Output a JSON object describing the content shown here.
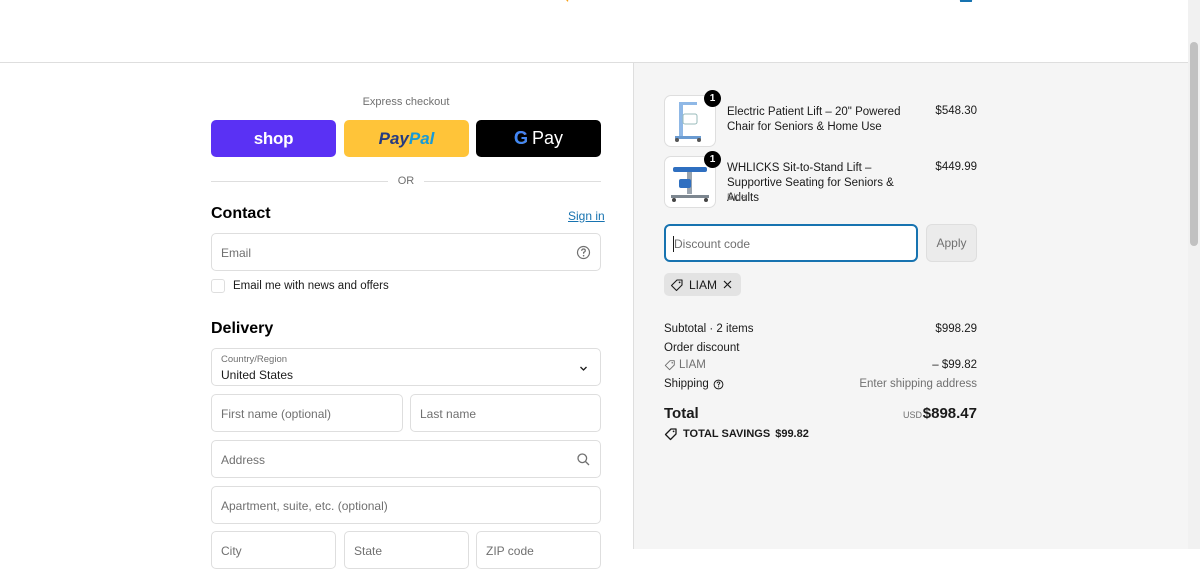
{
  "express": {
    "label": "Express checkout",
    "shop_label": "shop",
    "paypal_part1": "Pay",
    "paypal_part2": "Pal",
    "gpay_g": "G",
    "gpay_label": "Pay",
    "or_text": "OR"
  },
  "contact": {
    "title": "Contact",
    "signin": "Sign in",
    "email_placeholder": "Email",
    "newsletter_label": "Email me with news and offers"
  },
  "delivery": {
    "title": "Delivery",
    "country_label": "Country/Region",
    "country_value": "United States",
    "first_name_placeholder": "First name (optional)",
    "last_name_placeholder": "Last name",
    "address_placeholder": "Address",
    "apartment_placeholder": "Apartment, suite, etc. (optional)",
    "city_placeholder": "City",
    "state_placeholder": "State",
    "zip_placeholder": "ZIP code"
  },
  "summary": {
    "items": [
      {
        "name": "Electric Patient Lift – 20\" Powered Chair for Seniors & Home Use",
        "variant": "",
        "price": "$548.30",
        "qty": "1"
      },
      {
        "name": "WHLICKS Sit-to-Stand Lift – Supportive Seating for Seniors & Adults",
        "variant": "Blue",
        "price": "$449.99",
        "qty": "1"
      }
    ],
    "discount_placeholder": "Discount code",
    "apply_label": "Apply",
    "applied_code": "LIAM",
    "subtotal_label": "Subtotal · 2 items",
    "subtotal_value": "$998.29",
    "order_discount_label": "Order discount",
    "discount_code": "LIAM",
    "discount_value": "– $99.82",
    "shipping_label": "Shipping",
    "shipping_value": "Enter shipping address",
    "total_label": "Total",
    "currency": "USD",
    "total_value": "$898.47",
    "savings_label": "TOTAL SAVINGS",
    "savings_value": "$99.82"
  },
  "colors": {
    "shop": "#5a31f4",
    "paypal": "#ffc439",
    "gpay": "#000000",
    "link": "#1773b0",
    "summary_bg": "#f5f5f5"
  }
}
